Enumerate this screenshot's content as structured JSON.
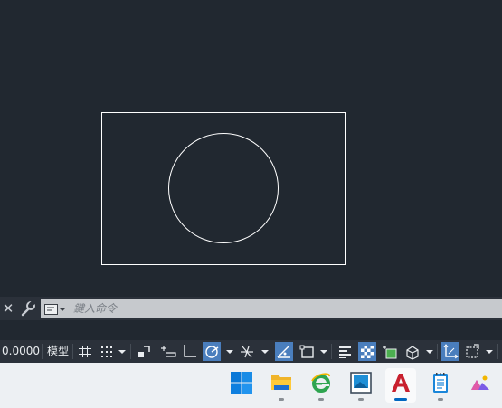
{
  "drawing": {
    "objects": [
      "rectangle",
      "circle"
    ],
    "line_color": "#ffffff",
    "background": "#212830"
  },
  "command_line": {
    "close_icon": "close-icon",
    "customize_icon": "wrench-icon",
    "history_icon": "command-history-icon",
    "placeholder": "鍵入命令"
  },
  "status_bar": {
    "coordinates": "0.0000",
    "model_label": "模型",
    "toggles": [
      {
        "icon": "grid-display-icon",
        "active": false
      },
      {
        "icon": "snap-mode-icon",
        "active": false
      },
      {
        "icon": "infer-constraints-icon",
        "active": false
      },
      {
        "icon": "dynamic-input-icon",
        "active": false
      },
      {
        "icon": "ortho-mode-icon",
        "active": false
      },
      {
        "icon": "polar-tracking-icon",
        "active": true
      },
      {
        "icon": "isometric-drafting-icon",
        "active": false
      },
      {
        "icon": "object-snap-tracking-icon",
        "active": true
      },
      {
        "icon": "object-snap-icon",
        "active": false
      },
      {
        "icon": "lineweight-icon",
        "active": false
      },
      {
        "icon": "transparency-icon",
        "active": true
      },
      {
        "icon": "selection-cycling-icon",
        "active": false
      },
      {
        "icon": "3d-object-snap-icon",
        "active": false
      },
      {
        "icon": "dynamic-ucs-icon",
        "active": true
      },
      {
        "icon": "selection-filter-icon",
        "active": false
      }
    ],
    "accent": "#4a7ebd"
  },
  "taskbar": {
    "items": [
      {
        "icon": "windows-start-icon",
        "active": false
      },
      {
        "icon": "file-explorer-icon",
        "active": false
      },
      {
        "icon": "internet-explorer-icon",
        "active": false
      },
      {
        "icon": "image-viewer-icon",
        "active": false
      },
      {
        "icon": "autocad-icon",
        "active": true
      },
      {
        "icon": "notepad-icon",
        "active": false
      },
      {
        "icon": "photos-app-icon",
        "active": false
      }
    ]
  }
}
